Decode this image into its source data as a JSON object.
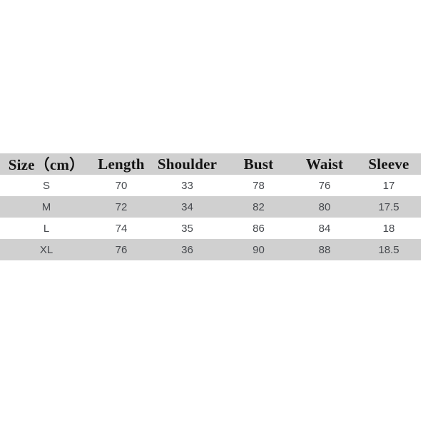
{
  "table": {
    "columns": [
      {
        "key": "size",
        "label": "Size（cm）"
      },
      {
        "key": "length",
        "label": "Length"
      },
      {
        "key": "shoulder",
        "label": "Shoulder"
      },
      {
        "key": "bust",
        "label": "Bust"
      },
      {
        "key": "waist",
        "label": "Waist"
      },
      {
        "key": "sleeve",
        "label": "Sleeve"
      }
    ],
    "rows": [
      {
        "size": "S",
        "length": "70",
        "shoulder": "33",
        "bust": "78",
        "waist": "76",
        "sleeve": "17"
      },
      {
        "size": "M",
        "length": "72",
        "shoulder": "34",
        "bust": "82",
        "waist": "80",
        "sleeve": "17.5"
      },
      {
        "size": "L",
        "length": "74",
        "shoulder": "35",
        "bust": "86",
        "waist": "84",
        "sleeve": "18"
      },
      {
        "size": "XL",
        "length": "76",
        "shoulder": "36",
        "bust": "90",
        "waist": "88",
        "sleeve": "18.5"
      }
    ]
  },
  "colors": {
    "page_background": "#ffffff",
    "header_band": "#d0d0d0",
    "row_light": "#ffffff",
    "row_dark": "#d0d0d0",
    "header_text": "#141414",
    "body_text": "#46494e"
  }
}
